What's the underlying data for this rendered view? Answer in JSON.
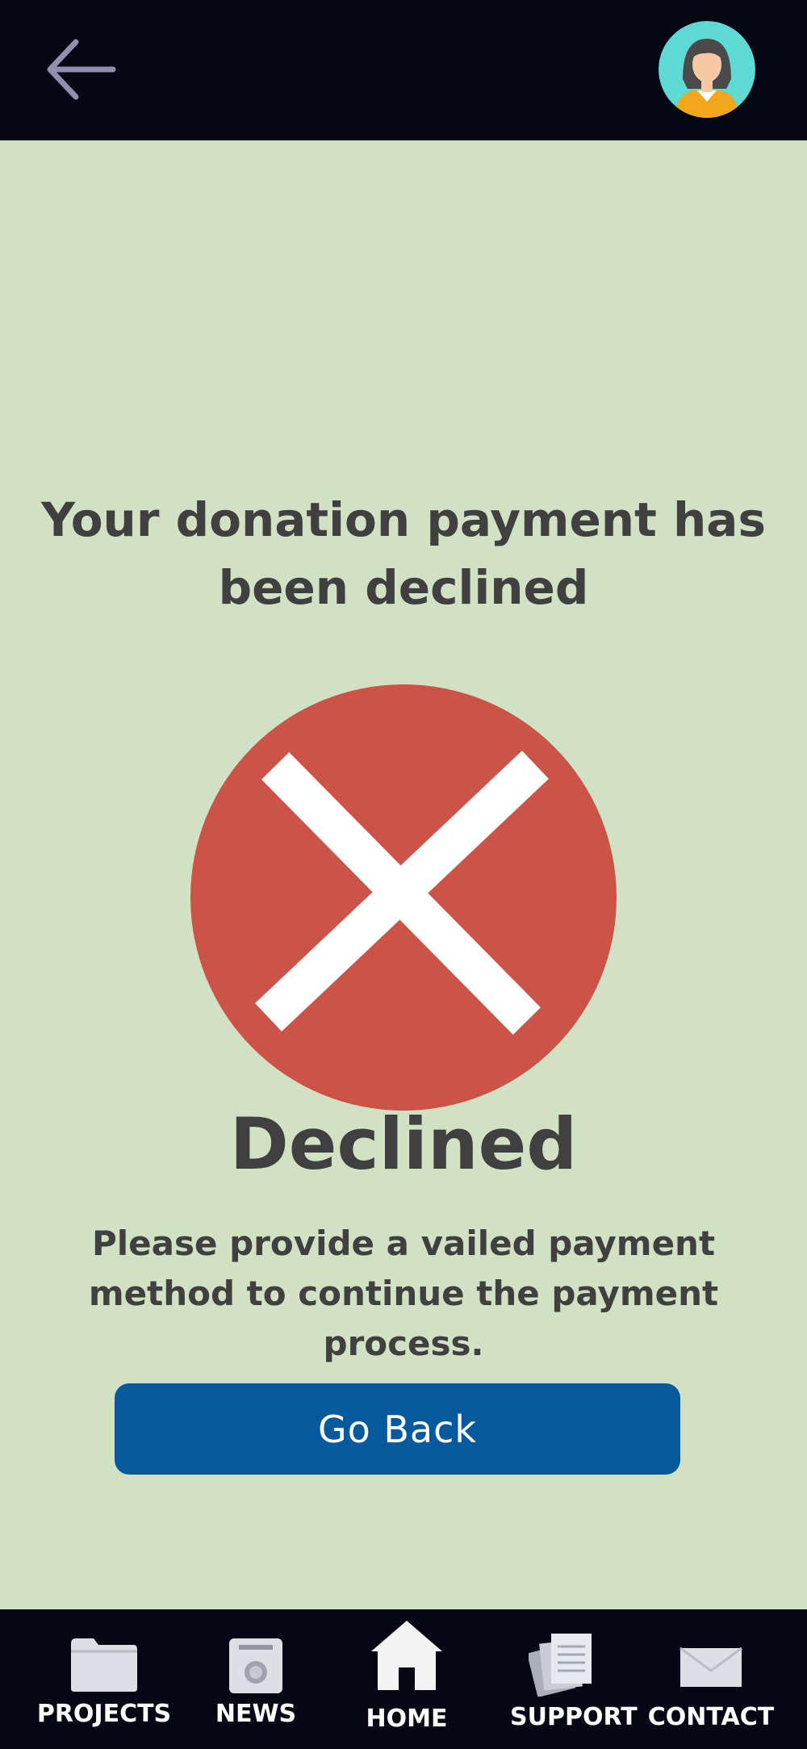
{
  "header": {
    "back_icon": "arrow-left-icon",
    "avatar_icon": "user-avatar-icon"
  },
  "main": {
    "title": "Your donation payment has been declined",
    "status_icon": "declined-x-icon",
    "status_word": "Declined",
    "message": "Please provide a vailed payment method to continue the payment process.",
    "button_label": "Go Back"
  },
  "colors": {
    "background": "#d1e2c4",
    "header": "#050714",
    "decline_red": "#cb5348",
    "button_blue": "#045a9c",
    "text": "#404040"
  },
  "navbar": {
    "items": [
      {
        "label": "PROJECTS",
        "icon": "folder-icon"
      },
      {
        "label": "NEWS",
        "icon": "newspaper-icon"
      },
      {
        "label": "HOME",
        "icon": "home-icon",
        "active": true
      },
      {
        "label": "SUPPORT",
        "icon": "documents-icon"
      },
      {
        "label": "CONTACT",
        "icon": "envelope-icon"
      }
    ]
  }
}
